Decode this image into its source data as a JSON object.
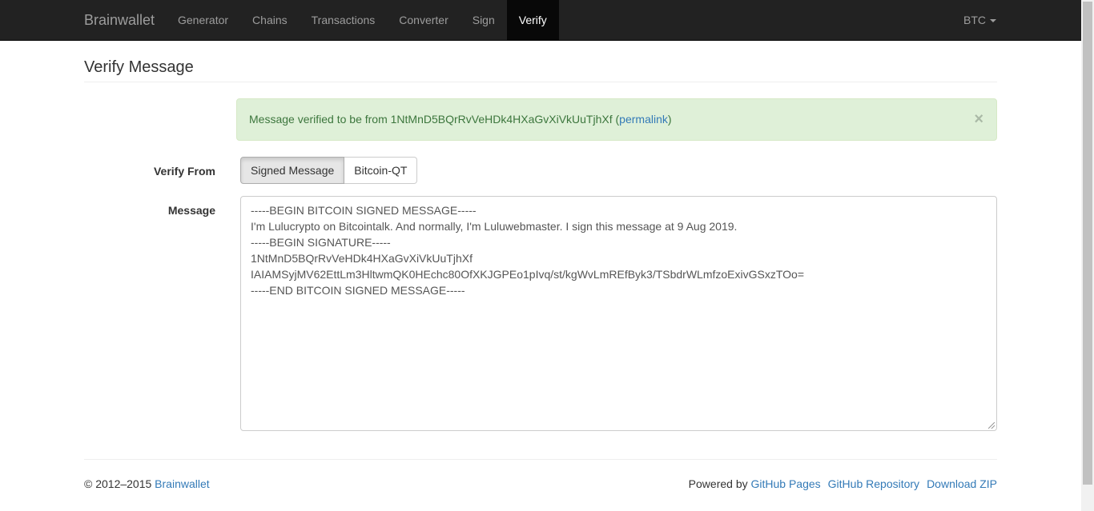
{
  "navbar": {
    "brand": "Brainwallet",
    "items": [
      {
        "label": "Generator"
      },
      {
        "label": "Chains"
      },
      {
        "label": "Transactions"
      },
      {
        "label": "Converter"
      },
      {
        "label": "Sign"
      },
      {
        "label": "Verify"
      }
    ],
    "active": "Verify",
    "coin": "BTC"
  },
  "page": {
    "title": "Verify Message"
  },
  "alert": {
    "text": "Message verified to be from 1NtMnD5BQrRvVeHDk4HXaGvXiVkUuTjhXf (",
    "link": "permalink",
    "suffix": ")",
    "close": "×"
  },
  "form": {
    "verify_from_label": "Verify From",
    "options": [
      "Signed Message",
      "Bitcoin-QT"
    ],
    "selected": "Signed Message",
    "message_label": "Message",
    "message_lines": [
      "-----BEGIN BITCOIN SIGNED MESSAGE-----",
      "I'm Lulucrypto on Bitcointalk. And normally, I'm Luluwebmaster. I sign this message at 9 Aug 2019.",
      "-----BEGIN SIGNATURE-----",
      "1NtMnD5BQrRvVeHDk4HXaGvXiVkUuTjhXf",
      "IAIAMSyjMV62EttLm3HltwmQK0HEchc80OfXKJGPEo1pIvq/st/kgWvLmREfByk3/TSbdrWLmfzoExivGSxzTOo=",
      "-----END BITCOIN SIGNED MESSAGE-----"
    ]
  },
  "footer": {
    "copyright": "© 2012–2015 ",
    "brand_link": "Brainwallet",
    "powered_by": "Powered by ",
    "links": [
      "GitHub Pages",
      "GitHub Repository",
      "Download ZIP"
    ]
  }
}
